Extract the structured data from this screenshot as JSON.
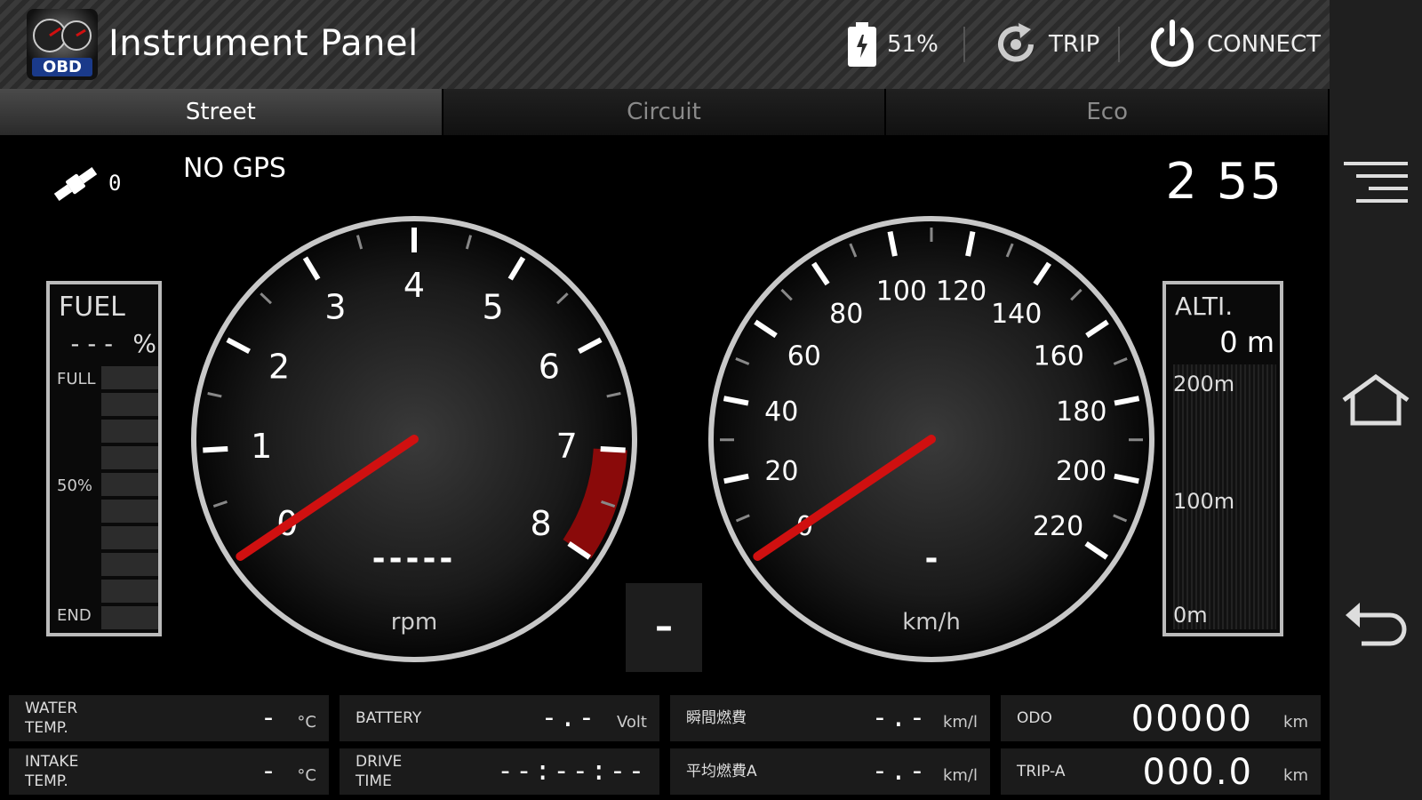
{
  "header": {
    "title": "Instrument Panel",
    "logo_text": "OBD",
    "battery_pct": "51%",
    "trip_label": "TRIP",
    "connect_label": "CONNECT"
  },
  "tabs": [
    {
      "label": "Street",
      "active": true
    },
    {
      "label": "Circuit",
      "active": false
    },
    {
      "label": "Eco",
      "active": false
    }
  ],
  "gps": {
    "satellites": "0",
    "status": "NO GPS"
  },
  "clock": "2 55",
  "fuel": {
    "title": "FUEL",
    "value": "---",
    "unit": "%",
    "label_full": "FULL",
    "label_half": "50%",
    "label_end": "END"
  },
  "altitude": {
    "title": "ALTI.",
    "value": "0 m",
    "labels": [
      "200m",
      "100m",
      "0m"
    ]
  },
  "tachometer": {
    "unit": "rpm",
    "readout": "-----",
    "ticks": [
      "0",
      "1",
      "2",
      "3",
      "4",
      "5",
      "6",
      "7",
      "8"
    ],
    "needle_value": 0,
    "redline_from": 7
  },
  "speedometer": {
    "unit": "km/h",
    "readout": "-",
    "ticks": [
      "0",
      "20",
      "40",
      "60",
      "80",
      "100",
      "120",
      "140",
      "160",
      "180",
      "200",
      "220"
    ],
    "needle_value": 0
  },
  "gear": "–",
  "info": {
    "water_temp": {
      "label_line1": "WATER",
      "label_line2": "TEMP.",
      "value": "-",
      "unit": "°C"
    },
    "intake_temp": {
      "label_line1": "INTAKE",
      "label_line2": "TEMP.",
      "value": "-",
      "unit": "°C"
    },
    "battery": {
      "label": "BATTERY",
      "value": "-.-",
      "unit": "Volt"
    },
    "drive_time": {
      "label_line1": "DRIVE",
      "label_line2": "TIME",
      "value": "--:--:--"
    },
    "instant_fuel": {
      "label": "瞬間燃費",
      "value": "-.-",
      "unit": "km/l"
    },
    "avg_fuel": {
      "label": "平均燃費A",
      "value": "-.-",
      "unit": "km/l"
    },
    "odo": {
      "label": "ODO",
      "value": "00000",
      "unit": "km"
    },
    "trip_a": {
      "label": "TRIP-A",
      "value": "000.0",
      "unit": "km"
    }
  },
  "colors": {
    "needle": "#d01010",
    "redline": "#8a0a0a",
    "bezel": "#c8c8c8"
  },
  "icons": [
    "satellite-icon",
    "battery-icon",
    "trip-reset-icon",
    "power-icon",
    "menu-icon",
    "home-icon",
    "back-icon"
  ]
}
